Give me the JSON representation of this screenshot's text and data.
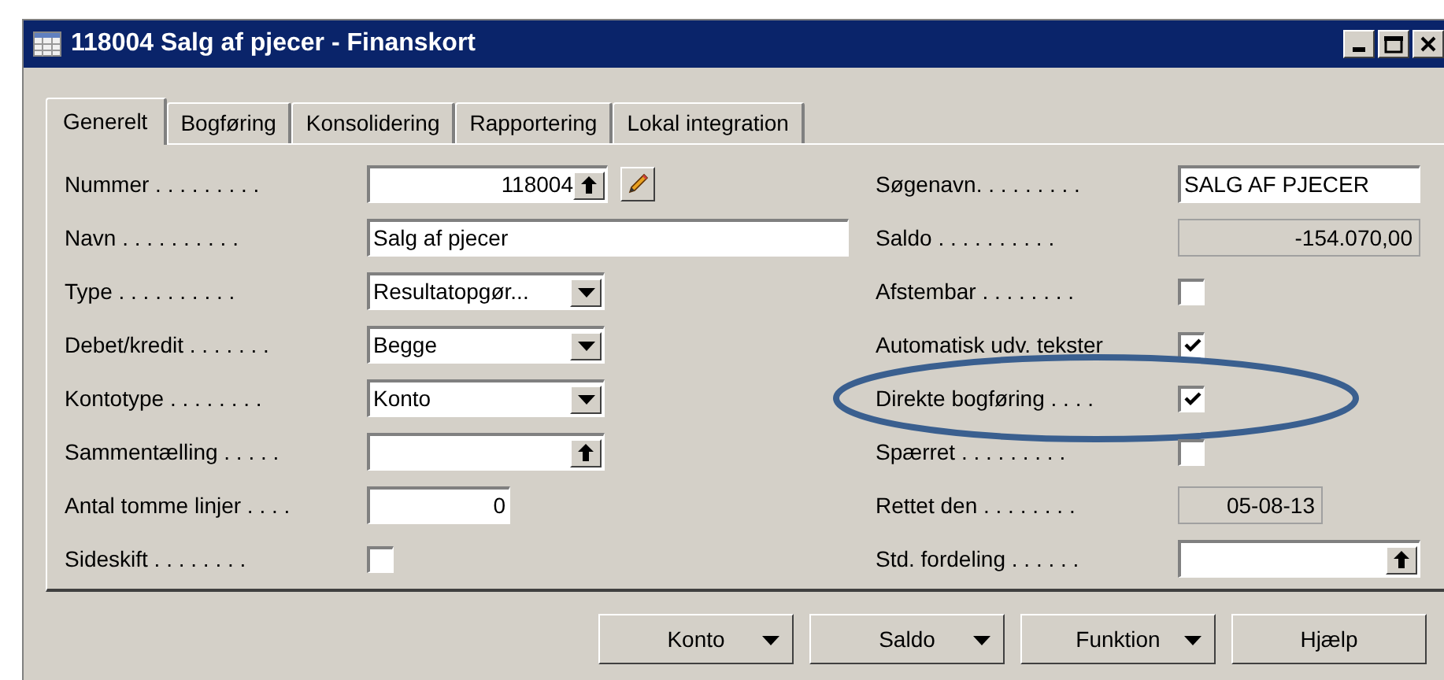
{
  "window": {
    "title": "118004 Salg af pjecer - Finanskort"
  },
  "tabs": [
    {
      "label": "Generelt",
      "selected": true
    },
    {
      "label": "Bogføring",
      "selected": false
    },
    {
      "label": "Konsolidering",
      "selected": false
    },
    {
      "label": "Rapportering",
      "selected": false
    },
    {
      "label": "Lokal integration",
      "selected": false
    }
  ],
  "left_fields": [
    {
      "label": "Nummer . . . . . . . . .",
      "kind": "number_lookup",
      "value": "118004",
      "edit_button": true
    },
    {
      "label": "Navn . . . . . . . . . .",
      "kind": "text",
      "value": "Salg af pjecer"
    },
    {
      "label": "Type . . . . . . . . . .",
      "kind": "dropdown",
      "value": "Resultatopgør..."
    },
    {
      "label": "Debet/kredit . . . . . . .",
      "kind": "dropdown",
      "value": "Begge"
    },
    {
      "label": "Kontotype . . . . . . . .",
      "kind": "dropdown",
      "value": "Konto"
    },
    {
      "label": "Sammentælling . . . . .",
      "kind": "lookup"
    },
    {
      "label": "Antal tomme linjer . . . .",
      "kind": "number",
      "value": "0"
    },
    {
      "label": "Sideskift . . . . . . . .",
      "kind": "checkbox",
      "checked": false
    }
  ],
  "right_fields": [
    {
      "label": "Søgenavn. . . . . . . . .",
      "kind": "text",
      "value": "SALG AF PJECER"
    },
    {
      "label": "Saldo . . . . . . . . . .",
      "kind": "readonly",
      "value": "-154.070,00"
    },
    {
      "label": "Afstembar . . . . . . . .",
      "kind": "checkbox",
      "checked": false
    },
    {
      "label": "Automatisk udv. tekster",
      "kind": "checkbox",
      "checked": true
    },
    {
      "label": "Direkte bogføring . . . .",
      "kind": "checkbox",
      "checked": true,
      "highlighted": true
    },
    {
      "label": "Spærret . . . . . . . . .",
      "kind": "checkbox",
      "checked": false
    },
    {
      "label": "Rettet den . . . . . . . .",
      "kind": "readonly",
      "value": "05-08-13"
    },
    {
      "label": "Std. fordeling . . . . . .",
      "kind": "lookup"
    }
  ],
  "buttons": [
    {
      "label": "Konto",
      "menu": true
    },
    {
      "label": "Saldo",
      "menu": true
    },
    {
      "label": "Funktion",
      "menu": true
    },
    {
      "label": "Hjælp",
      "menu": false
    }
  ]
}
